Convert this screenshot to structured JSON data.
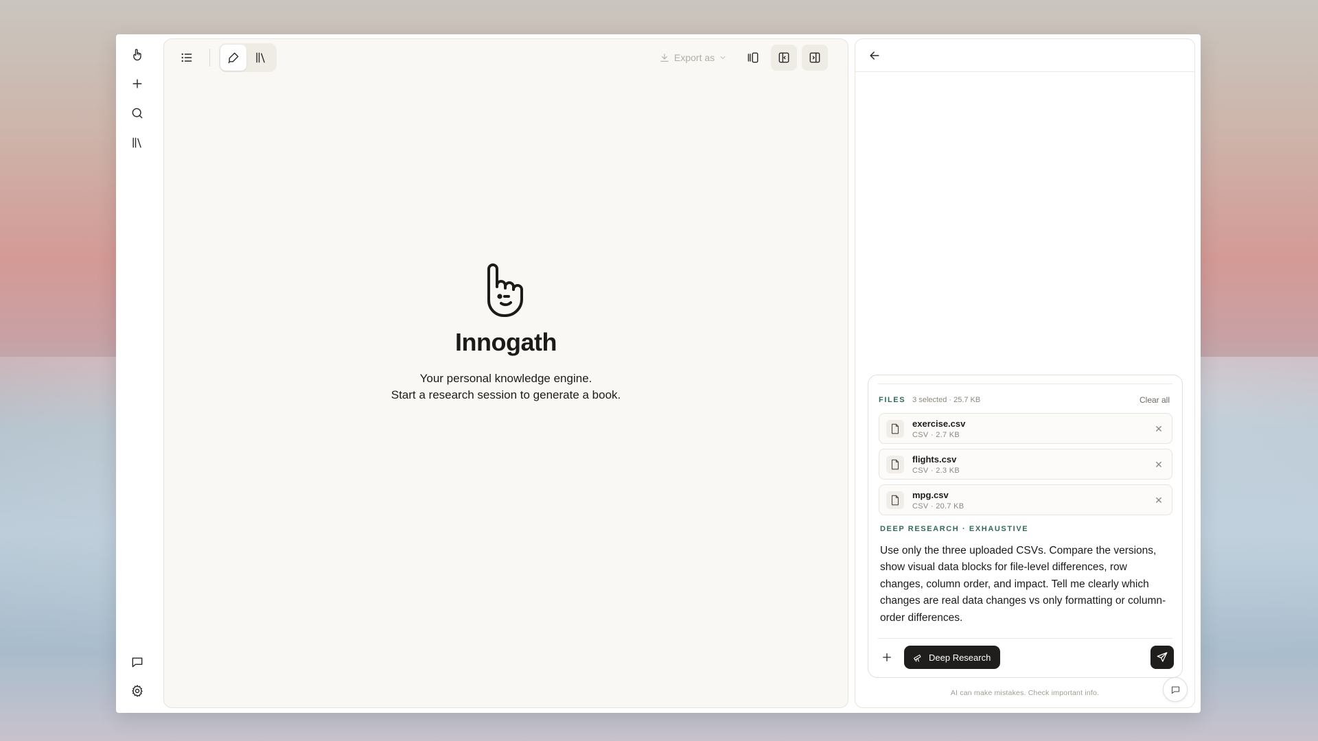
{
  "app": {
    "name": "Innogath",
    "tagline_line1": "Your personal knowledge engine.",
    "tagline_line2": "Start a research session to generate a book."
  },
  "sidebar": {
    "items": [
      {
        "name": "logo",
        "icon": "hand-logo-icon"
      },
      {
        "name": "new",
        "icon": "plus-icon"
      },
      {
        "name": "search",
        "icon": "search-icon"
      },
      {
        "name": "library",
        "icon": "library-icon"
      },
      {
        "name": "chat",
        "icon": "message-icon"
      },
      {
        "name": "settings",
        "icon": "gear-icon"
      }
    ]
  },
  "toolbar": {
    "export_label": "Export as",
    "icons": [
      "list-icon",
      "pen-icon",
      "library-icon",
      "download-icon",
      "chevron-down-icon",
      "panel-focus-icon",
      "panel-right-icon",
      "panel-collapse-icon"
    ]
  },
  "composer": {
    "files_label": "FILES",
    "files_meta": "3 selected · 25.7 KB",
    "clear_all": "Clear all",
    "files": [
      {
        "name": "exercise.csv",
        "meta": "CSV · 2.7 KB"
      },
      {
        "name": "flights.csv",
        "meta": "CSV · 2.3 KB"
      },
      {
        "name": "mpg.csv",
        "meta": "CSV · 20.7 KB"
      }
    ],
    "mode_label": "DEEP RESEARCH · EXHAUSTIVE",
    "prompt": "Use only the three uploaded CSVs. Compare the versions, show visual data blocks for file-level differences, row changes, column order, and impact. Tell me clearly which changes are real data changes vs only formatting or column-order differences.",
    "deep_research_label": "Deep Research"
  },
  "disclaimer": "AI can make mistakes. Check important info.",
  "colors": {
    "accent_green": "#2f6b5a",
    "dark_button": "#1f1e1c",
    "doc_background": "#faf8f4"
  }
}
